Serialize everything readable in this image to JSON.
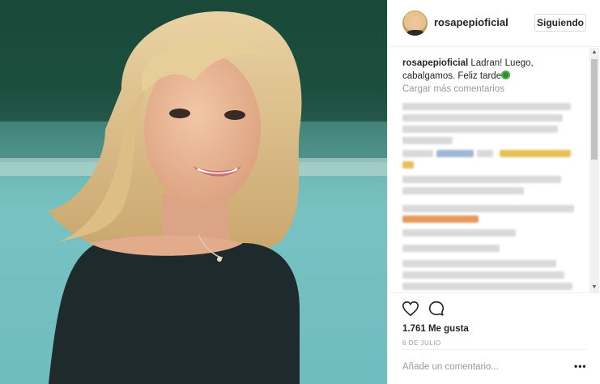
{
  "post": {
    "photo_alt": "",
    "username": "rosapepioficial",
    "follow_label": "Siguiendo",
    "caption_user": "rosapepioficial",
    "caption_text": "Ladran! Luego, cabalgamos. Feliz tarde",
    "caption_emoji": "clover-emoji",
    "load_more": "Cargar más comentarios",
    "likes": "1.761 Me gusta",
    "date": "6 DE JULIO",
    "comment_placeholder": "Añade un comentario...",
    "more_label": "•••"
  },
  "icons": {
    "like": "heart-icon",
    "comment": "speech-bubble-icon",
    "more": "ellipsis-icon"
  },
  "colors": {
    "text": "#262626",
    "muted": "#999999",
    "border": "#efefef"
  }
}
